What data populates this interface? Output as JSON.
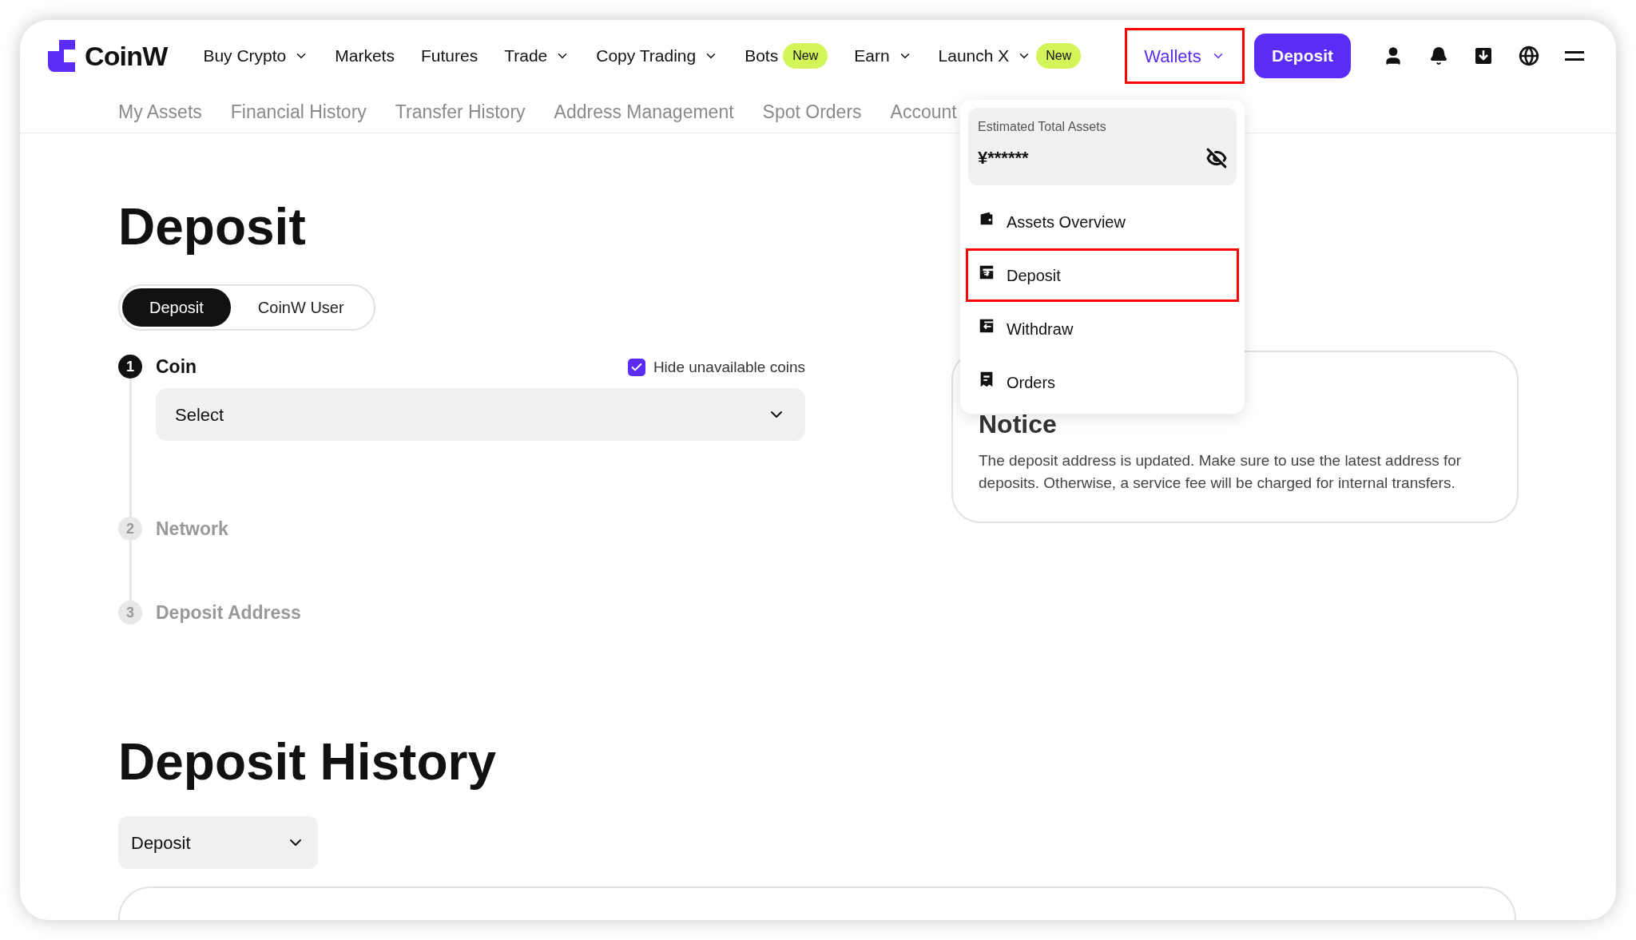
{
  "logo": {
    "text": "CoinW"
  },
  "nav": [
    {
      "label": "Buy Crypto",
      "dropdown": true
    },
    {
      "label": "Markets",
      "dropdown": false
    },
    {
      "label": "Futures",
      "dropdown": false
    },
    {
      "label": "Trade",
      "dropdown": true
    },
    {
      "label": "Copy Trading",
      "dropdown": true
    },
    {
      "label": "Bots",
      "dropdown": false,
      "badge": "New"
    },
    {
      "label": "Earn",
      "dropdown": true
    },
    {
      "label": "Launch X",
      "dropdown": true,
      "badge": "New"
    }
  ],
  "wallets": {
    "label": "Wallets",
    "highlighted": true
  },
  "deposit_button": {
    "label": "Deposit"
  },
  "subnav": [
    "My Assets",
    "Financial History",
    "Transfer History",
    "Address Management",
    "Spot Orders",
    "Account"
  ],
  "wallet_menu": {
    "estimate_label": "Estimated Total Assets",
    "estimate_value": "¥******",
    "items": [
      {
        "label": "Assets Overview",
        "kind": "wallet",
        "highlighted": false
      },
      {
        "label": "Deposit",
        "kind": "deposit",
        "highlighted": true
      },
      {
        "label": "Withdraw",
        "kind": "withdraw",
        "highlighted": false
      },
      {
        "label": "Orders",
        "kind": "orders",
        "highlighted": false
      }
    ]
  },
  "page_title": "Deposit",
  "mode_tabs": [
    {
      "label": "Deposit",
      "selected": true
    },
    {
      "label": "CoinW User",
      "selected": false
    }
  ],
  "steps": [
    {
      "number": "1",
      "label": "Coin",
      "active": true
    },
    {
      "number": "2",
      "label": "Network",
      "active": false
    },
    {
      "number": "3",
      "label": "Deposit Address",
      "active": false
    }
  ],
  "hide_unavailable": {
    "label": "Hide unavailable coins",
    "checked": true
  },
  "coin_select": {
    "value": "Select"
  },
  "notice": {
    "title": "Notice",
    "text": "The deposit address is updated. Make sure to use the latest address for deposits. Otherwise, a service fee will be charged for internal transfers."
  },
  "history": {
    "title": "Deposit History",
    "filter": "Deposit"
  }
}
